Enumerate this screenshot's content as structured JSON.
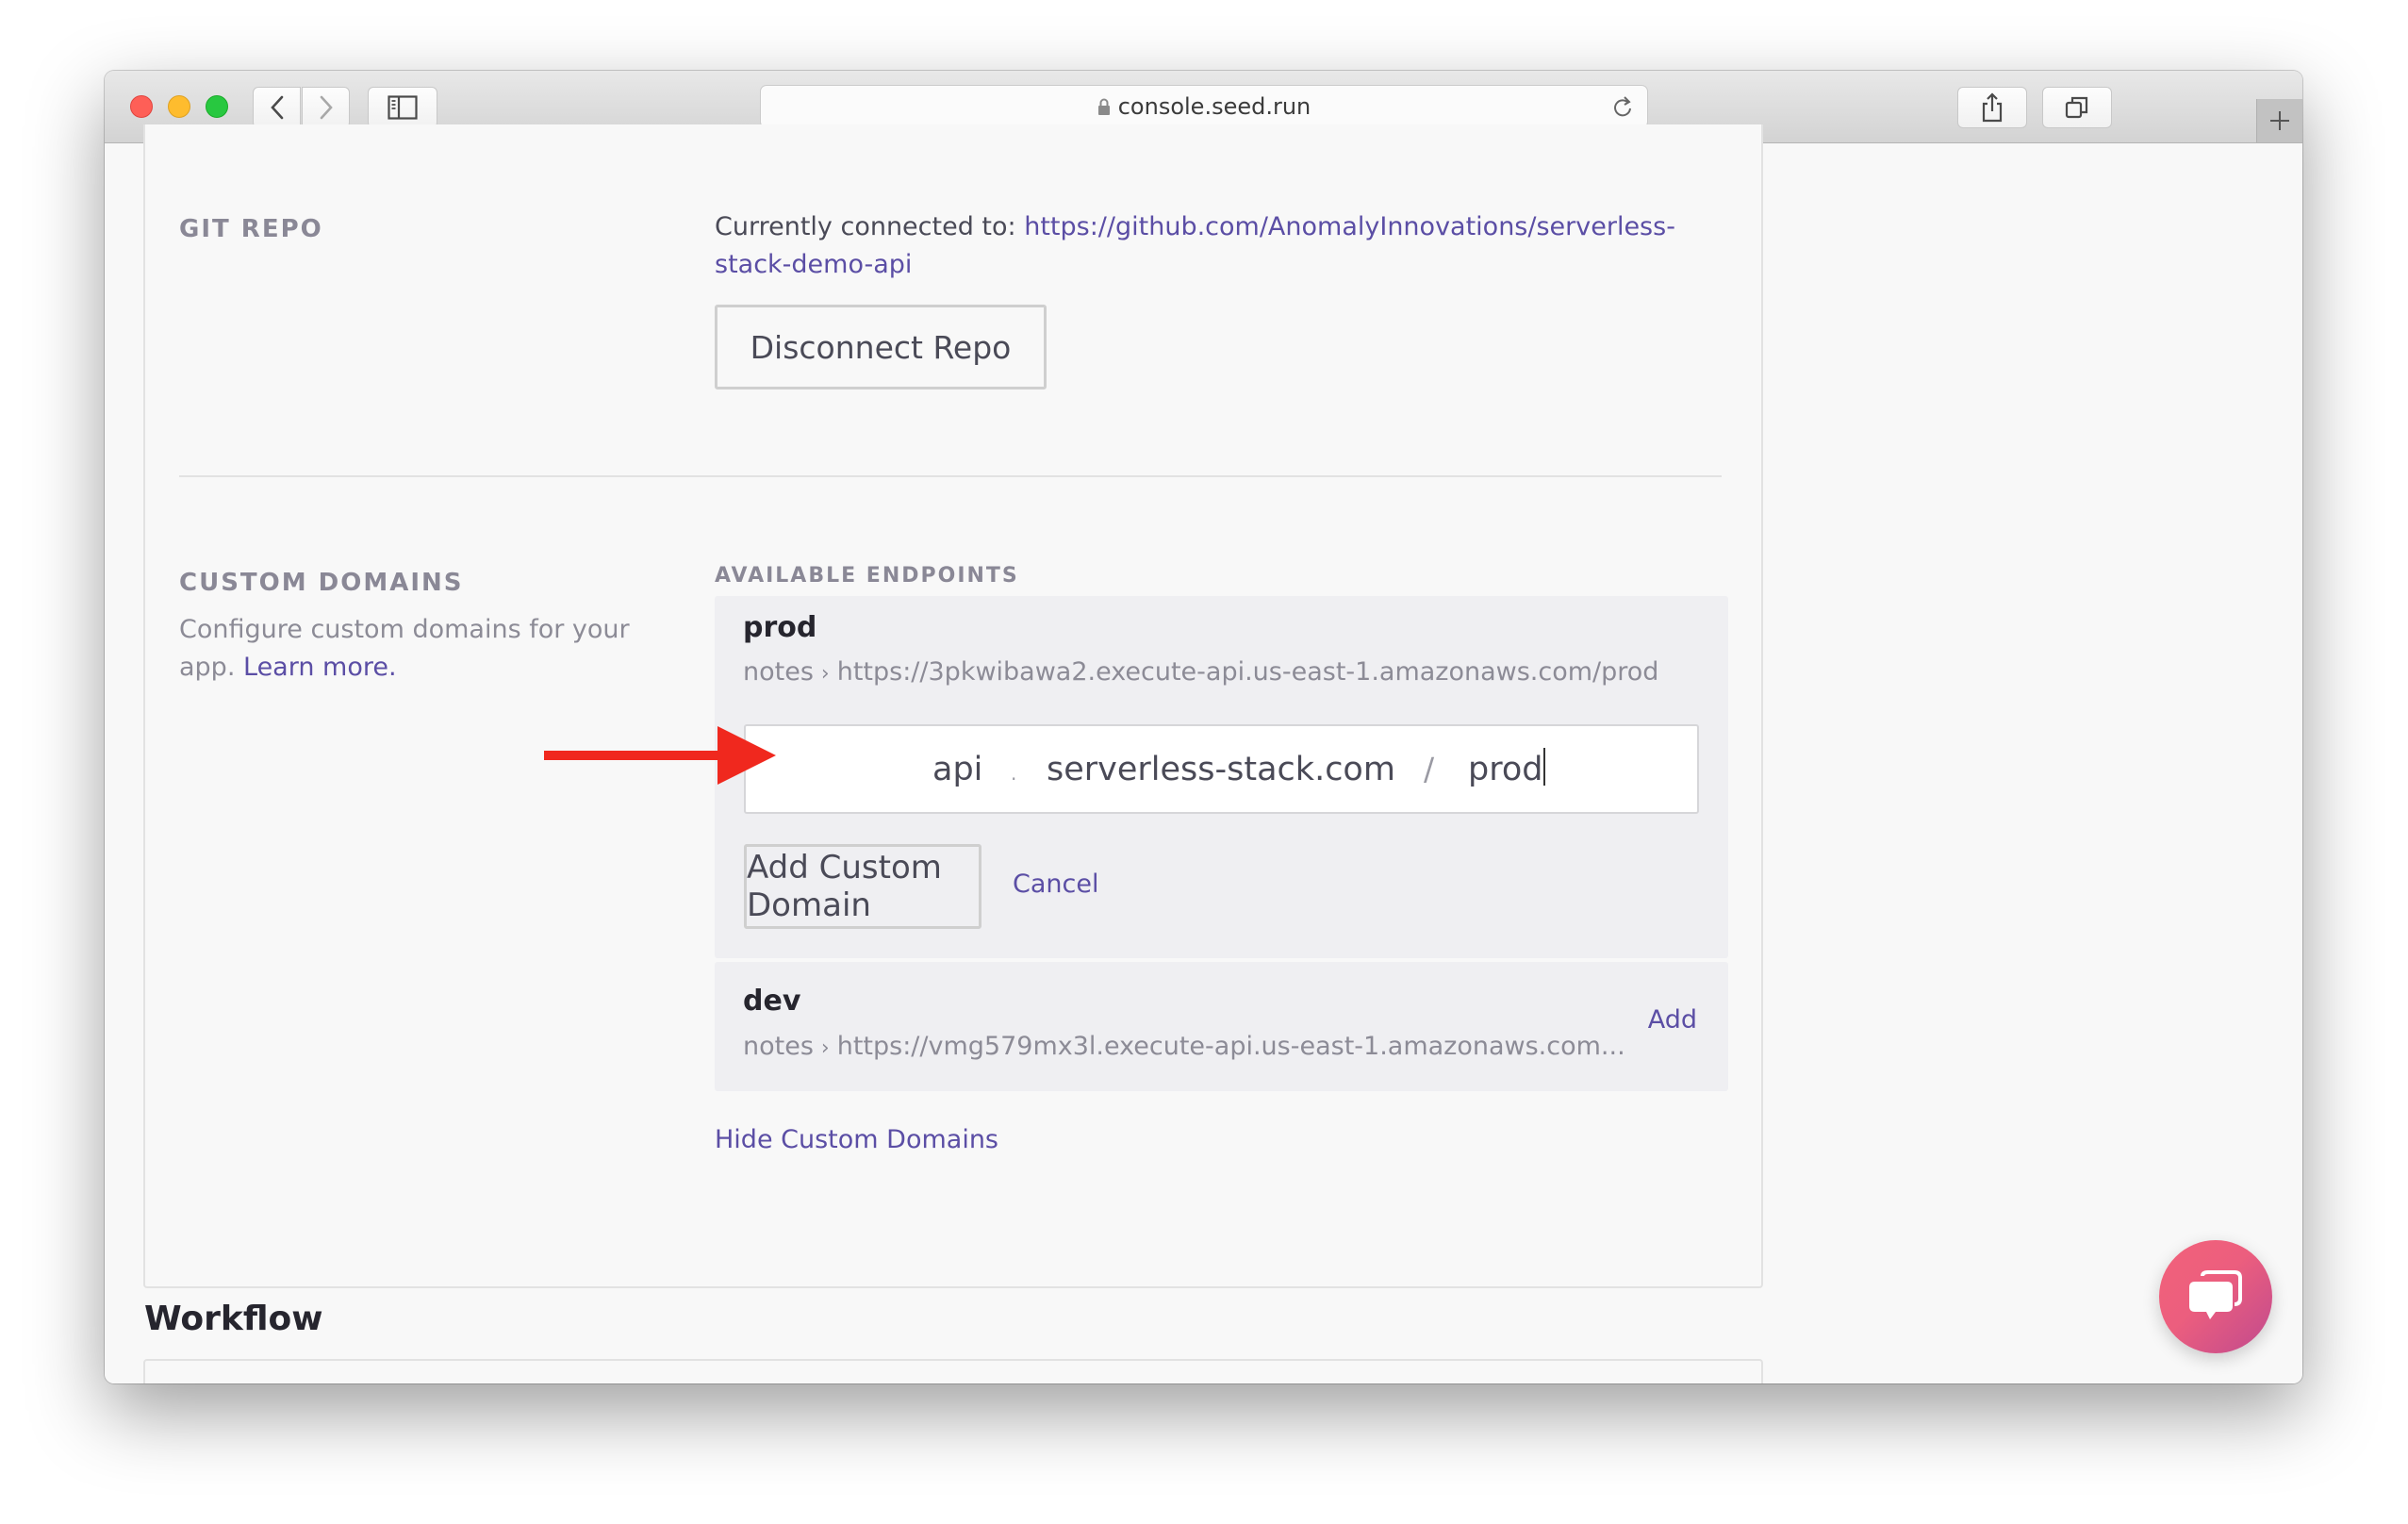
{
  "browser": {
    "address": "console.seed.run",
    "lock_icon": "lock-icon",
    "reload_icon": "reload-icon",
    "back_icon": "chevron-left-icon",
    "forward_icon": "chevron-right-icon",
    "sidebar_icon": "sidebar-icon",
    "share_icon": "share-icon",
    "tabs_icon": "tabs-overview-icon",
    "new_tab_icon": "plus-icon"
  },
  "git_repo": {
    "label": "GIT REPO",
    "connected_prefix": "Currently connected to: ",
    "repo_url_line1": "https://github.com/AnomalyInnovations/serverless-",
    "repo_url_line2": "stack-demo-api",
    "disconnect_button": "Disconnect Repo"
  },
  "custom_domains": {
    "label": "CUSTOM DOMAINS",
    "description": "Configure custom domains for your app. ",
    "description_line1": "Configure custom domains for your",
    "description_line2_prefix": "app. ",
    "learn_more": "Learn more.",
    "endpoints_label": "AVAILABLE ENDPOINTS",
    "endpoints": [
      {
        "stage": "prod",
        "service": "notes",
        "url": "https://3pkwibawa2.execute-api.us-east-1.amazonaws.com/prod"
      },
      {
        "stage": "dev",
        "service": "notes",
        "url": "https://vmg579mx3l.execute-api.us-east-1.amazonaws.com...",
        "add_label": "Add"
      }
    ],
    "form": {
      "subdomain_value": "api",
      "dot_separator": ".",
      "domain_value": "serverless-stack.com",
      "slash_separator": "/",
      "base_path_value": "prod",
      "add_button": "Add Custom Domain",
      "cancel_link": "Cancel"
    },
    "hide_link": "Hide Custom Domains",
    "annotation_arrow_color": "#f0281e"
  },
  "workflow": {
    "title": "Workflow"
  },
  "chat_widget": {
    "icon": "chat-bubbles-icon"
  },
  "colors": {
    "link": "#5b4ea5",
    "label": "#8a8896",
    "panel": "#efeff2",
    "chat_gradient_start": "#f2627a",
    "chat_gradient_end": "#c04a8e"
  }
}
